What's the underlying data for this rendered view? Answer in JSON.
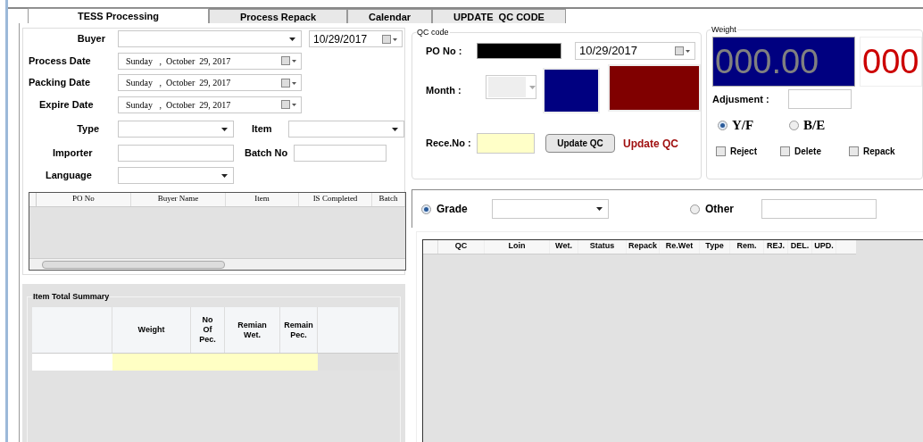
{
  "tabs": [
    {
      "label": "TESS Processing",
      "selected": true
    },
    {
      "label": "Process Repack",
      "selected": false
    },
    {
      "label": "Calendar",
      "selected": false
    },
    {
      "label": "UPDATE  QC CODE",
      "selected": false
    }
  ],
  "form": {
    "buyer_label": "Buyer",
    "buyer_date": "10/29/2017",
    "dates": [
      {
        "label": "Process Date",
        "value": "Sunday   ,  October  29, 2017"
      },
      {
        "label": "Packing Date",
        "value": "Sunday   ,  October  29, 2017"
      },
      {
        "label": "Expire Date",
        "value": "Sunday   ,  October  29, 2017"
      }
    ],
    "type_label": "Type",
    "item_label": "Item",
    "importer_label": "Importer",
    "batch_label": "Batch No",
    "language_label": "Language"
  },
  "po_table": {
    "columns": [
      "PO No",
      "Buyer Name",
      "Item",
      "IS Completed",
      "Batch"
    ]
  },
  "summary": {
    "title": "Item Total Summary",
    "columns": [
      "Weight",
      "No Of Pec.",
      "Remian Wet.",
      "Remain Pec."
    ]
  },
  "qc_code": {
    "title": "QC code",
    "po_label": "PO No :",
    "date": "10/29/2017",
    "month_label": "Month :",
    "rece_label": "Rece.No :",
    "button": "Update QC",
    "status": "Update QC"
  },
  "weight": {
    "title": "Weight",
    "reading": "000.00",
    "count": "000",
    "adjust_label": "Adjusment :",
    "radios": [
      {
        "label": "Y/F",
        "selected": true
      },
      {
        "label": "B/E",
        "selected": false
      }
    ],
    "checks": [
      {
        "label": "Reject",
        "checked": false
      },
      {
        "label": "Delete",
        "checked": false
      },
      {
        "label": "Repack",
        "checked": false
      }
    ]
  },
  "grade": {
    "options": [
      {
        "label": "Grade",
        "selected": true
      },
      {
        "label": "Other",
        "selected": false
      }
    ]
  },
  "qc_table": {
    "columns": [
      "QC",
      "Loin",
      "Wet.",
      "Status",
      "Repack",
      "Re.Wet",
      "Type",
      "Rem.",
      "REJ.",
      "DEL.",
      "UPD."
    ]
  }
}
